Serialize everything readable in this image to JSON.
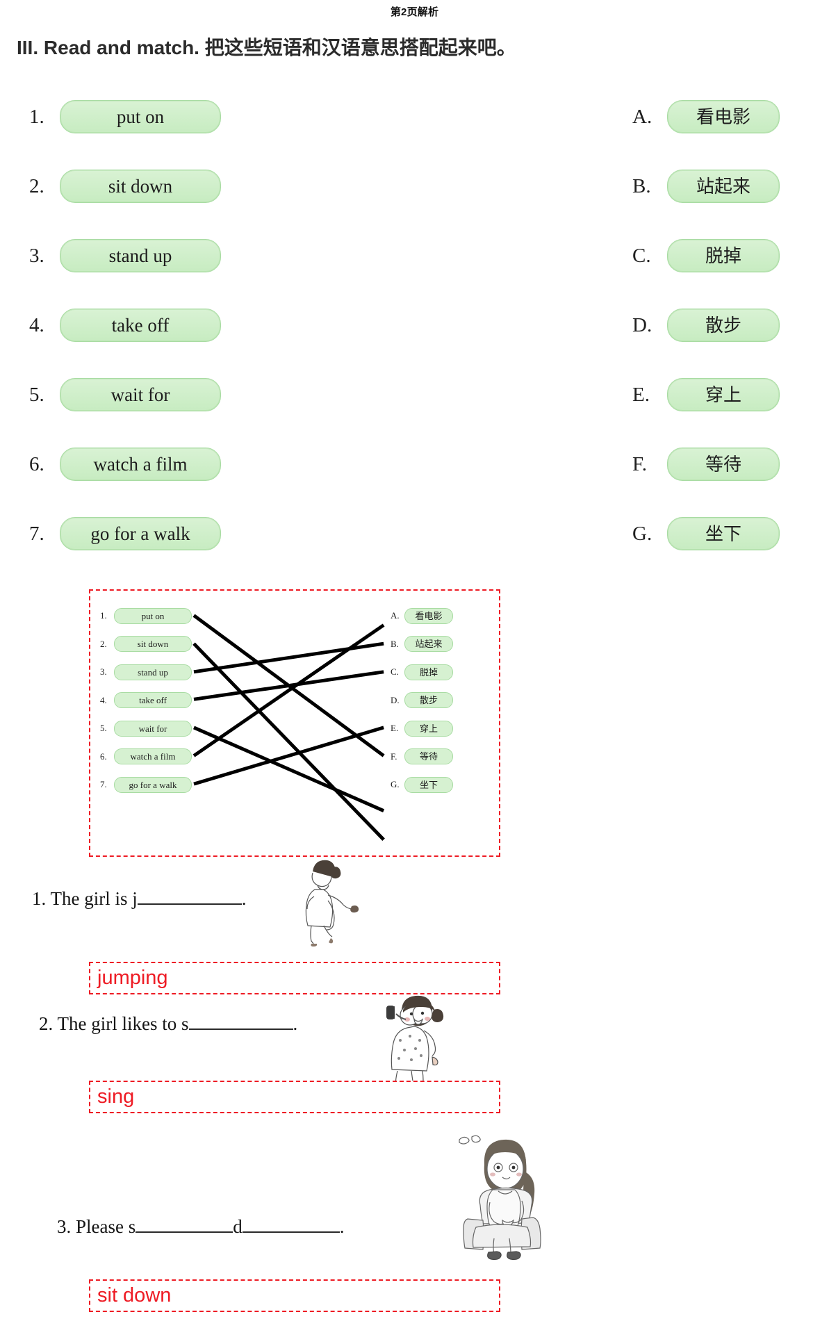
{
  "page_header": "第2页解析",
  "instruction": {
    "roman": "III.",
    "english": "Read and match.",
    "chinese": "把这些短语和汉语意思搭配起来吧。"
  },
  "match_exercise": {
    "left_items": [
      {
        "marker": "1.",
        "text": "put on"
      },
      {
        "marker": "2.",
        "text": "sit down"
      },
      {
        "marker": "3.",
        "text": "stand up"
      },
      {
        "marker": "4.",
        "text": "take off"
      },
      {
        "marker": "5.",
        "text": "wait for"
      },
      {
        "marker": "6.",
        "text": "watch a film"
      },
      {
        "marker": "7.",
        "text": "go for a walk"
      }
    ],
    "right_items": [
      {
        "marker": "A.",
        "text": "看电影"
      },
      {
        "marker": "B.",
        "text": "站起来"
      },
      {
        "marker": "C.",
        "text": "脱掉"
      },
      {
        "marker": "D.",
        "text": "散步"
      },
      {
        "marker": "E.",
        "text": "穿上"
      },
      {
        "marker": "F.",
        "text": "等待"
      },
      {
        "marker": "G.",
        "text": "坐下"
      }
    ],
    "answer_matches": [
      {
        "from": "1",
        "to": "E"
      },
      {
        "from": "2",
        "to": "G"
      },
      {
        "from": "3",
        "to": "B"
      },
      {
        "from": "4",
        "to": "C"
      },
      {
        "from": "5",
        "to": "F"
      },
      {
        "from": "6",
        "to": "A"
      },
      {
        "from": "7",
        "to": "D"
      }
    ]
  },
  "fill_in_questions": [
    {
      "number": "1.",
      "before": "The girl is j",
      "after": ".",
      "answer": "jumping",
      "illustration": "girl-jumping"
    },
    {
      "number": "2.",
      "before": "The girl likes to s",
      "after": ".",
      "answer": "sing",
      "illustration": "girl-singing"
    },
    {
      "number": "3.",
      "before": "Please s",
      "middle": "d",
      "after": ".",
      "answer": "sit down",
      "illustration": "girl-sitting-armchair"
    }
  ],
  "colors": {
    "pill_fill": "#cfeecb",
    "pill_border": "#a9dca3",
    "answer_red": "#ee1b24",
    "text": "#1a1a1a"
  }
}
